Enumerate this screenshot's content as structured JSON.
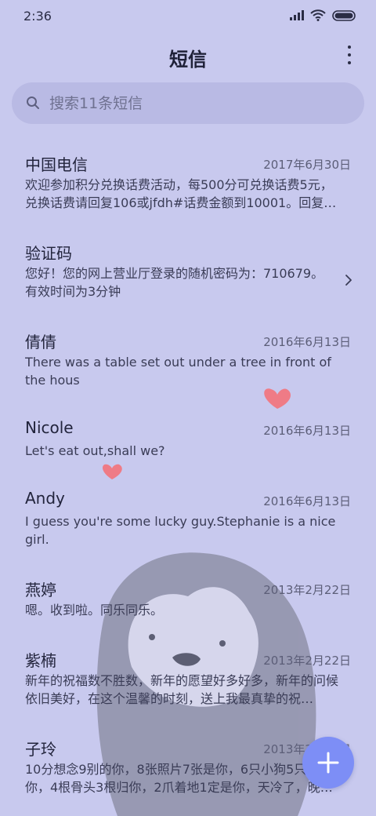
{
  "status_bar": {
    "time": "2:36"
  },
  "header": {
    "title": "短信"
  },
  "search": {
    "placeholder": "搜索11条短信"
  },
  "conversations": [
    {
      "name": "中国电信",
      "date": "2017年6月30日",
      "preview": "欢迎参加积分兑换话费活动，每500分可兑换话费5元，兑换话费请回复106或jfdh#话费金额到10001。回复…"
    },
    {
      "name": "验证码",
      "date": "",
      "preview": "您好！您的网上营业厅登录的随机密码为：710679。有效时间为3分钟"
    },
    {
      "name": "倩倩",
      "date": "2016年6月13日",
      "preview": "There was a table set out under a tree in front of the hous"
    },
    {
      "name": "Nicole",
      "date": "2016年6月13日",
      "preview": "Let's eat out,shall we?"
    },
    {
      "name": "Andy",
      "date": "2016年6月13日",
      "preview": "I guess you're some lucky guy.Stephanie is a nice girl."
    },
    {
      "name": "燕婷",
      "date": "2013年2月22日",
      "preview": "嗯。收到啦。同乐同乐。"
    },
    {
      "name": "紫楠",
      "date": "2013年2月22日",
      "preview": "新年的祝福数不胜数，新年的愿望好多好多，新年的问候依旧美好，在这个温馨的时刻，送上我最真挚的祝…"
    },
    {
      "name": "子玲",
      "date": "2013年2月22日",
      "preview": "10分想念9别的你，8张照片7张是你，6只小狗5只像你，4根骨头3根归你，2爪着地1定是你，天冷了，晚上记…"
    }
  ],
  "colors": {
    "background": "#c8c9ee",
    "search_bg": "#b9bae4",
    "fab": "#7d8ef6",
    "heart": "#ef7b86"
  }
}
